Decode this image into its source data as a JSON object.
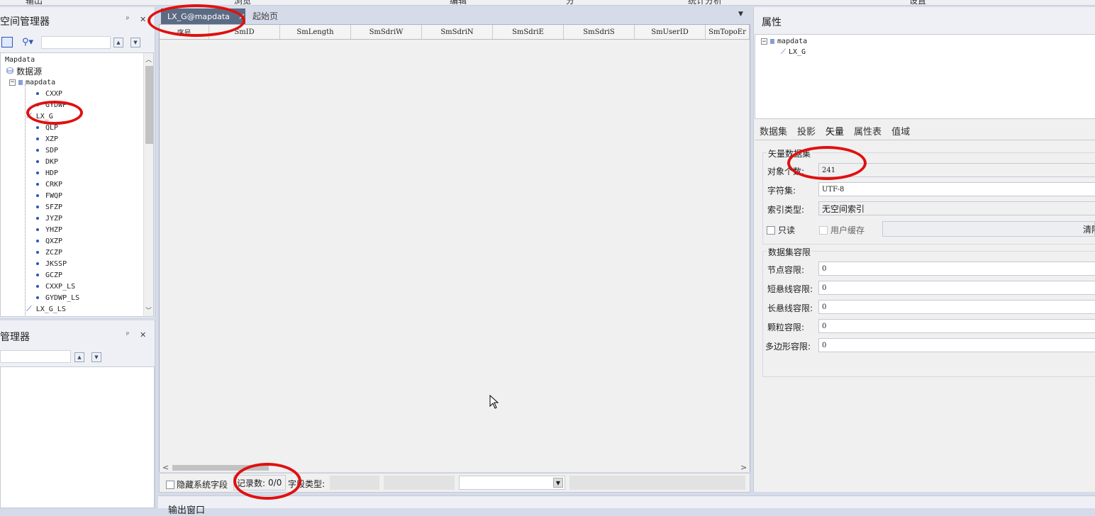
{
  "topbar": {
    "items": [
      "输出",
      "浏览",
      "编辑",
      "分",
      "统计分析",
      "设置"
    ]
  },
  "workspace": {
    "title": "空间管理器",
    "pin": "ᵖ",
    "close": "✕",
    "tree": {
      "root": "Mapdata",
      "datasource": "数据源",
      "db": "mapdata",
      "items": [
        {
          "name": "CXXP",
          "type": "point"
        },
        {
          "name": "GYDWP",
          "type": "point"
        },
        {
          "name": "LX_G",
          "type": "line"
        },
        {
          "name": "QLP",
          "type": "point"
        },
        {
          "name": "XZP",
          "type": "point"
        },
        {
          "name": "SDP",
          "type": "point"
        },
        {
          "name": "DKP",
          "type": "point"
        },
        {
          "name": "HDP",
          "type": "point"
        },
        {
          "name": "CRKP",
          "type": "point"
        },
        {
          "name": "FWQP",
          "type": "point"
        },
        {
          "name": "SFZP",
          "type": "point"
        },
        {
          "name": "JYZP",
          "type": "point"
        },
        {
          "name": "YHZP",
          "type": "point"
        },
        {
          "name": "QXZP",
          "type": "point"
        },
        {
          "name": "ZCZP",
          "type": "point"
        },
        {
          "name": "JKSSP",
          "type": "point"
        },
        {
          "name": "GCZP",
          "type": "point"
        },
        {
          "name": "CXXP_LS",
          "type": "point"
        },
        {
          "name": "GYDWP_LS",
          "type": "point"
        },
        {
          "name": "LX_G_LS",
          "type": "line"
        }
      ]
    }
  },
  "layer_manager": {
    "title": "管理器",
    "pin": "ᵖ",
    "close": "✕"
  },
  "tabs": [
    {
      "label": "LX_G@mapdata",
      "active": true,
      "close": "×"
    },
    {
      "label": "起始页",
      "active": false
    }
  ],
  "tab_dropdown": "▼",
  "grid": {
    "columns": [
      "序号",
      "SmID",
      "SmLength",
      "SmSdriW",
      "SmSdriN",
      "SmSdriE",
      "SmSdriS",
      "SmUserID",
      "SmTopoEr"
    ]
  },
  "statusbar": {
    "hide_system_fields": "隐藏系统字段",
    "record_count_label": "记录数:",
    "record_count": "0/0",
    "field_type_label": "字段类型:"
  },
  "output": {
    "title": "输出窗口"
  },
  "properties": {
    "title": "属性",
    "tree": {
      "root": "mapdata",
      "child": "LX_G"
    },
    "tabs": [
      "数据集",
      "投影",
      "矢量",
      "属性表",
      "值域"
    ],
    "vector_group": "矢量数据集",
    "fields": [
      {
        "label": "对象个数:",
        "value": "241"
      },
      {
        "label": "字符集:",
        "value": "UTF-8"
      },
      {
        "label": "索引类型:",
        "value": "无空间索引"
      }
    ],
    "readonly": "只读",
    "user_cache": "用户缓存",
    "clear": "清除",
    "tolerance_group": "数据集容限",
    "tolerances": [
      {
        "label": "节点容限:",
        "value": "0"
      },
      {
        "label": "短悬线容限:",
        "value": "0"
      },
      {
        "label": "长悬线容限:",
        "value": "0"
      },
      {
        "label": "颗粒容限:",
        "value": "0"
      },
      {
        "label": "多边形容限:",
        "value": "0"
      }
    ]
  }
}
